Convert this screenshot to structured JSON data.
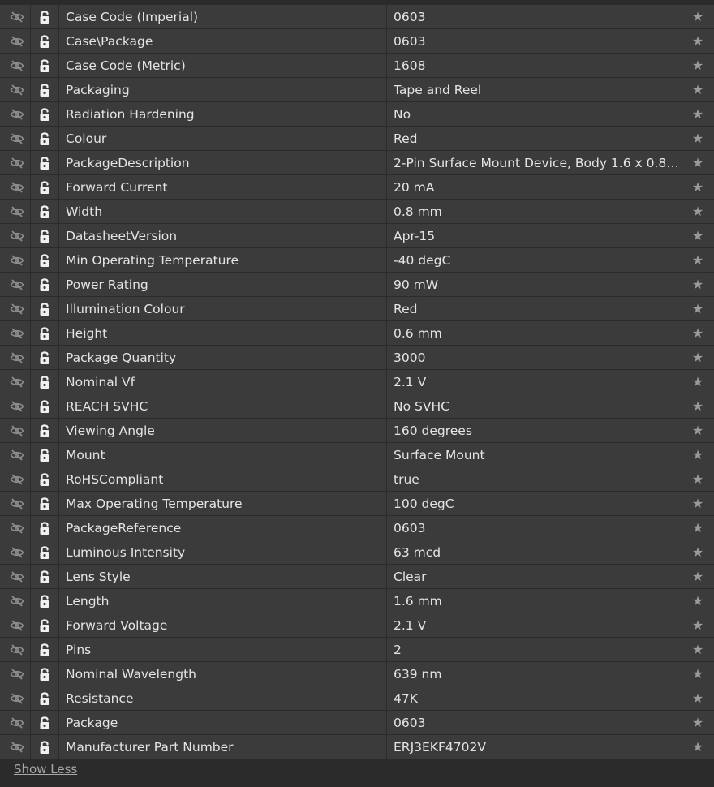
{
  "rows": [
    {
      "name": "Case Code (Imperial)",
      "value": "0603"
    },
    {
      "name": "Case\\Package",
      "value": "0603"
    },
    {
      "name": "Case Code (Metric)",
      "value": "1608"
    },
    {
      "name": "Packaging",
      "value": "Tape and Reel"
    },
    {
      "name": "Radiation Hardening",
      "value": "No"
    },
    {
      "name": "Colour",
      "value": "Red"
    },
    {
      "name": "PackageDescription",
      "value": "2-Pin Surface Mount Device, Body 1.6 x 0.85..."
    },
    {
      "name": "Forward Current",
      "value": "20 mA"
    },
    {
      "name": "Width",
      "value": "0.8 mm"
    },
    {
      "name": "DatasheetVersion",
      "value": "Apr-15"
    },
    {
      "name": "Min Operating Temperature",
      "value": "-40 degC"
    },
    {
      "name": "Power Rating",
      "value": "90 mW"
    },
    {
      "name": "Illumination Colour",
      "value": "Red"
    },
    {
      "name": "Height",
      "value": "0.6 mm"
    },
    {
      "name": "Package Quantity",
      "value": "3000"
    },
    {
      "name": "Nominal Vf",
      "value": "2.1 V"
    },
    {
      "name": "REACH SVHC",
      "value": "No SVHC"
    },
    {
      "name": "Viewing Angle",
      "value": "160 degrees"
    },
    {
      "name": "Mount",
      "value": "Surface Mount"
    },
    {
      "name": "RoHSCompliant",
      "value": "true"
    },
    {
      "name": "Max Operating Temperature",
      "value": "100 degC"
    },
    {
      "name": "PackageReference",
      "value": "0603"
    },
    {
      "name": "Luminous Intensity",
      "value": "63 mcd"
    },
    {
      "name": "Lens Style",
      "value": "Clear"
    },
    {
      "name": "Length",
      "value": "1.6 mm"
    },
    {
      "name": "Forward Voltage",
      "value": "2.1 V"
    },
    {
      "name": "Pins",
      "value": "2"
    },
    {
      "name": "Nominal Wavelength",
      "value": "639 nm"
    },
    {
      "name": "Resistance",
      "value": "47K"
    },
    {
      "name": "Package",
      "value": "0603"
    },
    {
      "name": "Manufacturer Part Number",
      "value": "ERJ3EKF4702V"
    }
  ],
  "icons": {
    "visibility": "eye-slash-icon",
    "lock": "unlocked-padlock-icon",
    "favorite": "star-icon"
  },
  "footer": {
    "toggle_label": "Show Less"
  },
  "colors": {
    "background": "#2b2b2b",
    "row": "#3b3b3b",
    "icon": "#8c8c8c",
    "lock": "#f0f0f0"
  }
}
